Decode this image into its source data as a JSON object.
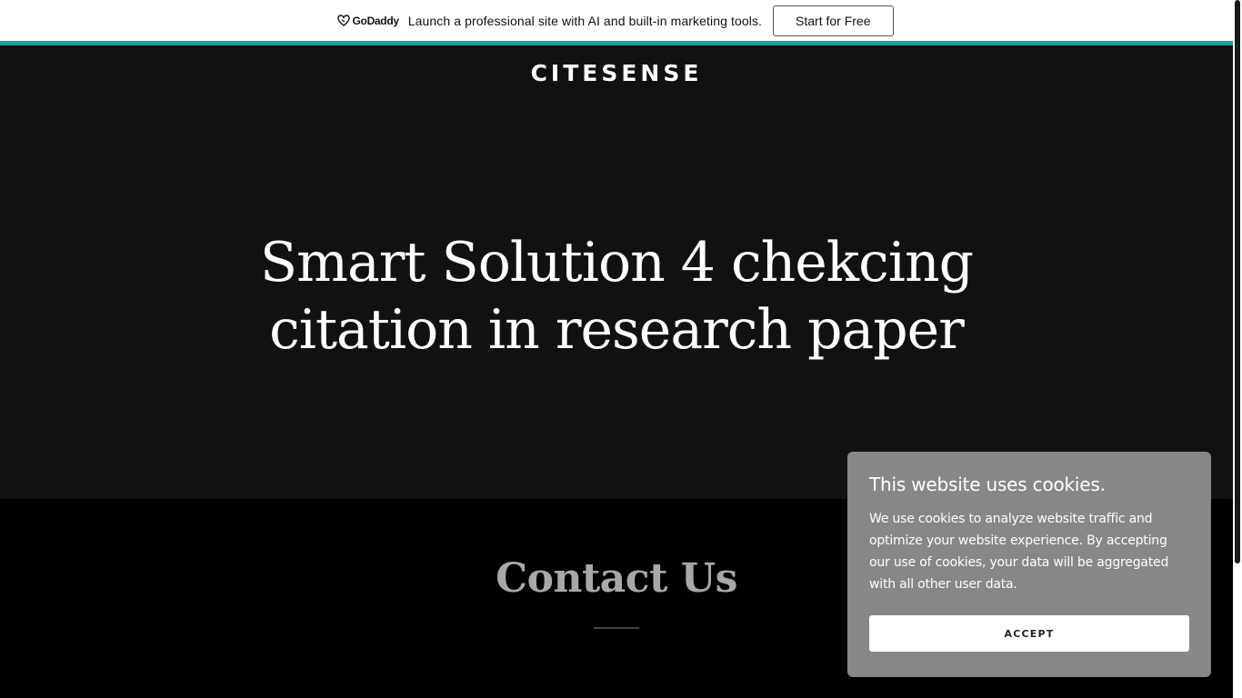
{
  "promo": {
    "logo_text": "GoDaddy",
    "message": "Launch a professional site with AI and built-in marketing tools.",
    "cta_label": "Start for Free"
  },
  "colors": {
    "accent_rule": "#1d9e9b",
    "hero_background": "#111111",
    "cookie_background": "#878787"
  },
  "hero": {
    "site_title": "CITESENSE",
    "heading_line1": "Smart Solution 4 chekcing",
    "heading_line2": "citation in research paper"
  },
  "contact": {
    "title": "Contact Us"
  },
  "cookie": {
    "title": "This website uses cookies.",
    "body": "We use cookies to analyze website traffic and optimize your website experience. By accepting our use of cookies, your data will be aggregated with all other user data.",
    "accept_label": "ACCEPT"
  }
}
